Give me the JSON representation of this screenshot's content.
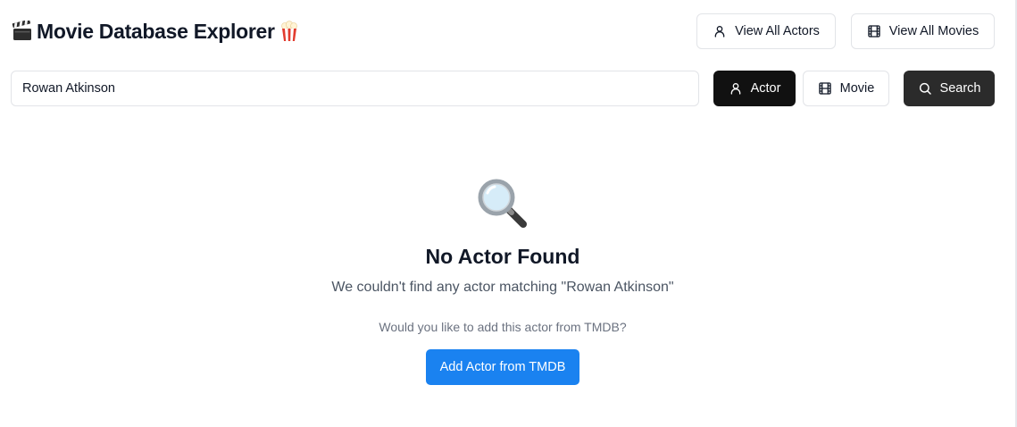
{
  "header": {
    "title": "Movie Database Explorer",
    "title_left_icon": "clapper-board-icon",
    "title_right_icon": "popcorn-icon",
    "view_all_actors_label": "View All Actors",
    "view_all_movies_label": "View All Movies"
  },
  "search": {
    "value": "Rowan Atkinson",
    "type_options": [
      {
        "label": "Actor",
        "icon": "user-icon",
        "selected": true
      },
      {
        "label": "Movie",
        "icon": "film-icon",
        "selected": false
      }
    ],
    "search_label": "Search"
  },
  "empty_state": {
    "icon": "magnifying-glass-icon",
    "title": "No Actor Found",
    "message": "We couldn't find any actor matching \"Rowan Atkinson\"",
    "prompt": "Would you like to add this actor from TMDB?",
    "action_label": "Add Actor from TMDB"
  },
  "colors": {
    "primary": "#1a82f0",
    "selected_toggle": "#111111",
    "search_button": "#2b2b2b",
    "border": "#e2e4e8"
  }
}
